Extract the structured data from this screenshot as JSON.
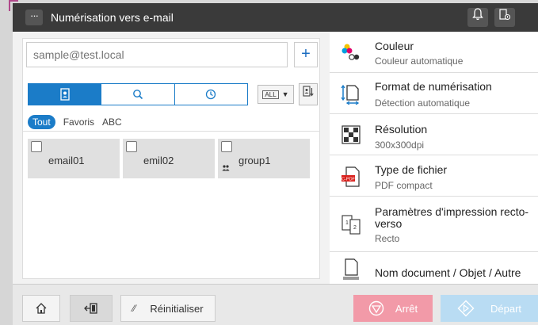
{
  "header": {
    "menu_label": "···",
    "title": "Numérisation vers e-mail"
  },
  "address": {
    "placeholder": "sample@test.local",
    "add_label": "+"
  },
  "dest_all": "ALL",
  "filters": [
    "Tout",
    "Favoris",
    "ABC"
  ],
  "destinations": [
    {
      "label": "email01"
    },
    {
      "label": "emil02"
    },
    {
      "label": "group1"
    }
  ],
  "settings": [
    {
      "title": "Couleur",
      "value": "Couleur automatique",
      "icon": "color-icon"
    },
    {
      "title": "Format de numérisation",
      "value": "Détection automatique",
      "icon": "scan-size-icon"
    },
    {
      "title": "Résolution",
      "value": "300x300dpi",
      "icon": "resolution-icon"
    },
    {
      "title": "Type de fichier",
      "value": "PDF compact",
      "icon": "file-type-icon"
    },
    {
      "title": "Paramètres d'impression recto-verso",
      "value": "Recto",
      "icon": "duplex-icon"
    },
    {
      "title": "Nom document / Objet / Autre",
      "value": "",
      "icon": "document-name-icon"
    }
  ],
  "file_icon_text": "C-PDF",
  "duplex_icon_text": [
    "1",
    "2"
  ],
  "bottom": {
    "reset_label": "Réinitialiser",
    "stop_label": "Arrêt",
    "start_label": "Départ"
  },
  "colors": {
    "accent": "#1b7cc8",
    "stop": "#f29aa8",
    "start": "#b9dcf3",
    "topbar": "#3a3a3a"
  }
}
